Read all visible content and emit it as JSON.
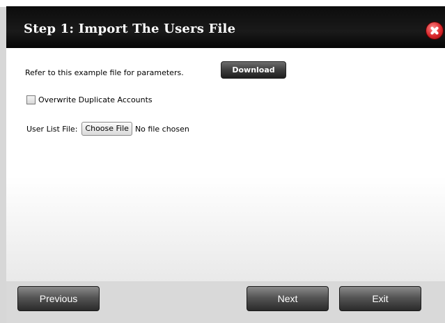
{
  "dialog": {
    "title": "Step 1: Import The Users File"
  },
  "content": {
    "refer_text": "Refer to this example file for parameters.",
    "download_label": "Download",
    "overwrite_label": "Overwrite Duplicate Accounts",
    "overwrite_checked": false,
    "user_list_label": "User List File:",
    "choose_file_label": "Choose File",
    "file_status": "No file chosen"
  },
  "footer": {
    "previous_label": "Previous",
    "next_label": "Next",
    "exit_label": "Exit"
  },
  "icons": {
    "close": "close-icon"
  },
  "colors": {
    "title_bar": "#111111",
    "close_button": "#d8262a",
    "nav_button": "#555555"
  }
}
